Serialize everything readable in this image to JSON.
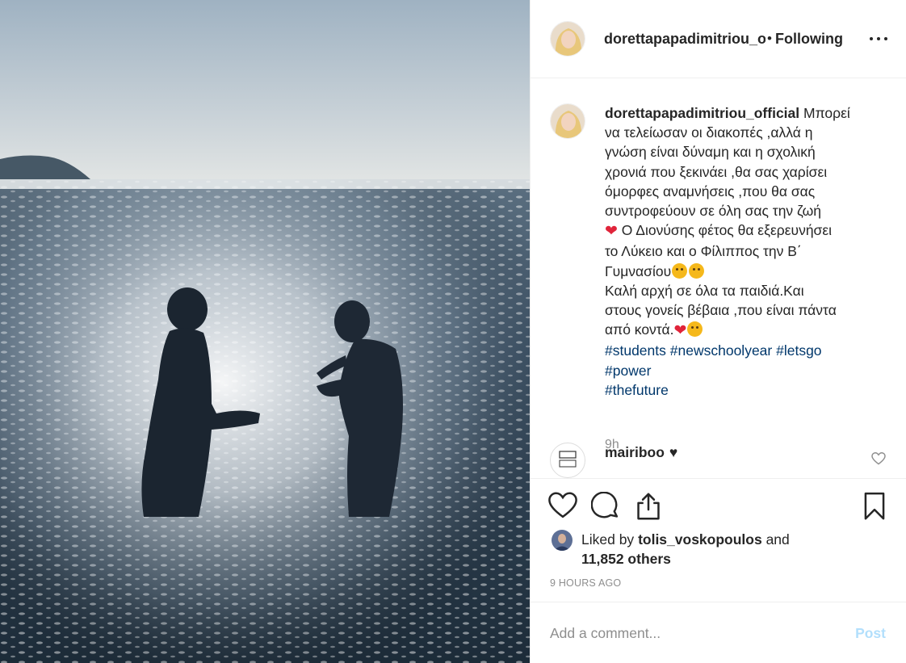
{
  "post": {
    "username": "dorettapapadimitriou_official",
    "header_username": "dorettapapadimitriou_o",
    "separator": "•",
    "follow_status": "Following",
    "caption_lines": [
      "να τελείωσαν οι διακοπές ,αλλά η",
      "γνώση είναι δύναμη και η σχολική",
      "χρονιά που ξεκινάει ,θα σας χαρίσει",
      "όμορφες αναμνήσεις ,που θα σας",
      "συντροφεύουν σε όλη σας την ζωή"
    ],
    "caption_first": "Μπορεί",
    "caption_heart_line_a": " Ο Διονύσης φέτος θα εξερευνήσει",
    "caption_heart_line_b": "το Λύκειο και ο Φίλιππος την Β΄",
    "caption_heart_line_c": "Γυμνασίου",
    "caption_line_d": "Καλή αρχή σε όλα τα παιδιά.Και",
    "caption_line_e": "στους γονείς βέβαια ,που είναι πάντα",
    "caption_line_f": "από κοντά.",
    "hashtags": [
      "#students",
      "#newschoolyear",
      "#letsgo",
      "#power",
      "#thefuture"
    ],
    "caption_time": "9h",
    "comment": {
      "user": "mairiboo",
      "text": "♥"
    },
    "likes": {
      "by": "tolis_voskopoulos",
      "and_text": "Liked by",
      "and2": "and",
      "others": "11,852 others"
    },
    "time_ago": "9 HOURS AGO"
  },
  "icons": {
    "like": "heart-icon",
    "comment": "comment-bubble-icon",
    "share": "share-icon",
    "save": "bookmark-icon",
    "more": "more-options-icon"
  },
  "add_comment": {
    "placeholder": "Add a comment...",
    "post_label": "Post"
  },
  "colors": {
    "link": "#00376b",
    "post_disabled": "#b2dffc",
    "muted": "#8e8e8e",
    "heart": "#e0243a"
  }
}
